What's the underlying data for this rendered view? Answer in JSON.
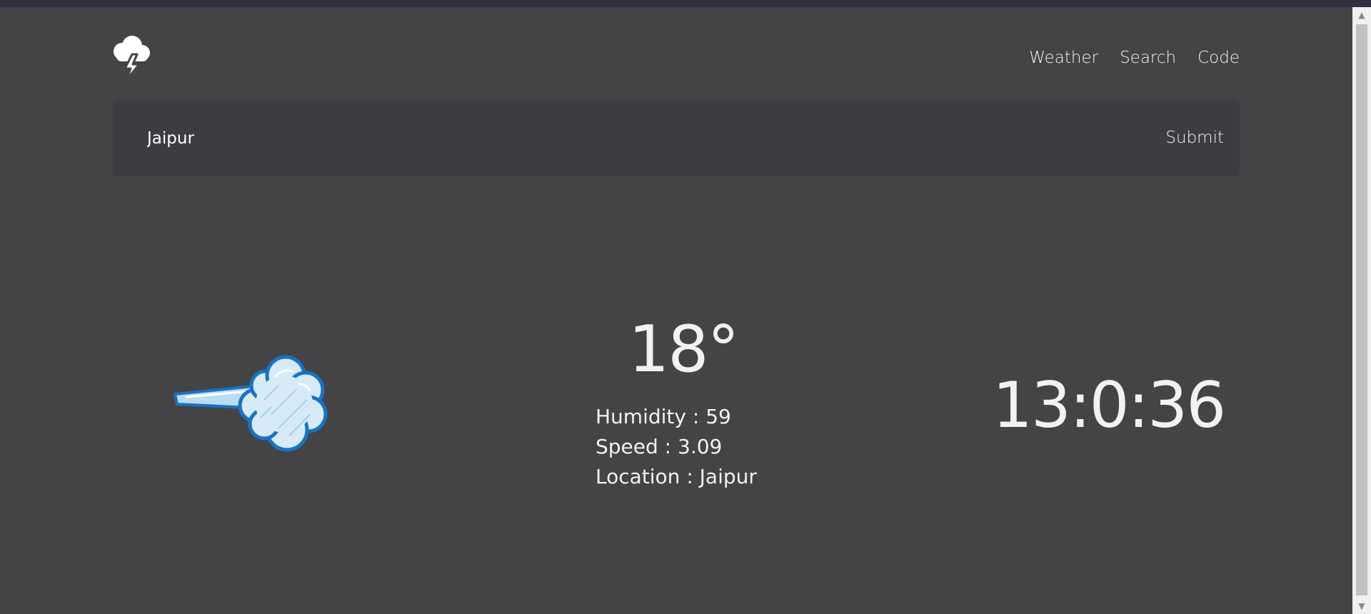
{
  "nav": {
    "items": [
      "Weather",
      "Search",
      "Code"
    ]
  },
  "search": {
    "value": "Jaipur",
    "submit_label": "Submit"
  },
  "weather": {
    "temperature": "18°",
    "humidity": "Humidity : 59",
    "speed": "Speed : 3.09",
    "location": "Location : Jaipur"
  },
  "clock": {
    "time": "13:0:36"
  },
  "icons": {
    "logo": "storm-cloud-icon",
    "condition": "wind-icon"
  },
  "colors": {
    "background": "#444446",
    "panel": "#3d3c41",
    "accent": "#1a72c4"
  }
}
